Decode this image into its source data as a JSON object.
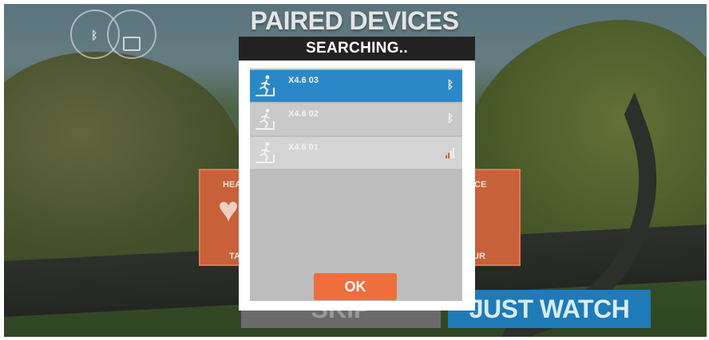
{
  "screen": {
    "title": "PAIRED DEVICES",
    "icons": [
      "bluetooth-icon",
      "ant-plus-icon"
    ]
  },
  "tiles": {
    "left": {
      "top_text": "HEA",
      "icon": "heart-rate-icon",
      "bottom_text": "TA"
    },
    "right": {
      "top_text": "CE",
      "bottom_text": "UR"
    }
  },
  "bottom_buttons": {
    "skip_label": "SKIP",
    "watch_label": "JUST WATCH"
  },
  "modal": {
    "title": "SEARCHING..",
    "devices": [
      {
        "name": "X4.6 03",
        "icon": "treadmill-runner-icon",
        "status": "bluetooth",
        "selected": true
      },
      {
        "name": "X4.6 02",
        "icon": "treadmill-runner-icon",
        "status": "bluetooth",
        "selected": false
      },
      {
        "name": "X4.6 01",
        "icon": "treadmill-runner-icon",
        "status": "signal-strength",
        "selected": false
      }
    ],
    "ok_label": "OK"
  },
  "colors": {
    "accent_orange": "#ee6e3c",
    "selected_blue": "#2b88c8",
    "header_dark": "#222222",
    "watch_blue": "#1f7ab8"
  }
}
